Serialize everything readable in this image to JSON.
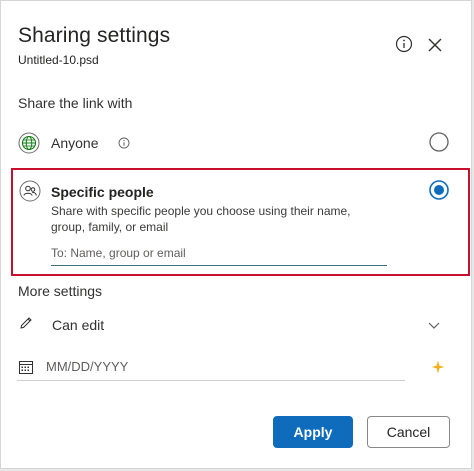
{
  "dialog": {
    "title": "Sharing settings",
    "filename": "Untitled-10.psd"
  },
  "share": {
    "section_label": "Share the link with",
    "anyone_label": "Anyone",
    "specific_title": "Specific people",
    "specific_desc": "Share with specific people you choose using their name, group, family, or email",
    "input_placeholder": "To: Name, group or email",
    "selected_option": "Specific people"
  },
  "more": {
    "section_label": "More settings",
    "permission_value": "Can edit",
    "date_placeholder": "MM/DD/YYYY"
  },
  "buttons": {
    "apply": "Apply",
    "cancel": "Cancel"
  },
  "colors": {
    "accent": "#0f6cbd",
    "highlight": "#c8102e",
    "sparkle": "#f2b01e"
  }
}
